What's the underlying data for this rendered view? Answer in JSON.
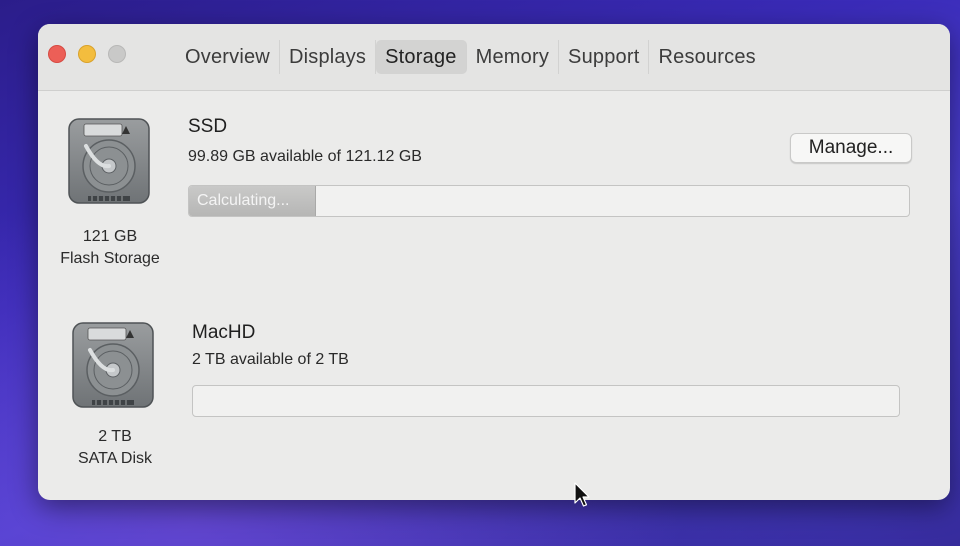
{
  "window": {
    "tabs": [
      {
        "label": "Overview"
      },
      {
        "label": "Displays"
      },
      {
        "label": "Storage"
      },
      {
        "label": "Memory"
      },
      {
        "label": "Support"
      },
      {
        "label": "Resources"
      }
    ],
    "active_tab": "Storage"
  },
  "drives": [
    {
      "icon": "hard-drive-icon",
      "size_label": "121 GB",
      "type_label": "Flash Storage",
      "volume_name": "SSD",
      "availability": "99.89 GB available of 121.12 GB",
      "bar_status": "Calculating...",
      "used_fraction": 0.175,
      "manage_label": "Manage..."
    },
    {
      "icon": "hard-drive-icon",
      "size_label": "2 TB",
      "type_label": "SATA Disk",
      "volume_name": "MacHD",
      "availability": "2 TB available of 2 TB",
      "used_fraction": 0
    }
  ],
  "colors": {
    "close": "#ec5f57",
    "minimize": "#f3bd3e",
    "zoom_disabled": "#c9c9c8",
    "window_bg": "#ebebea",
    "desktop": "#3a2bb8"
  }
}
